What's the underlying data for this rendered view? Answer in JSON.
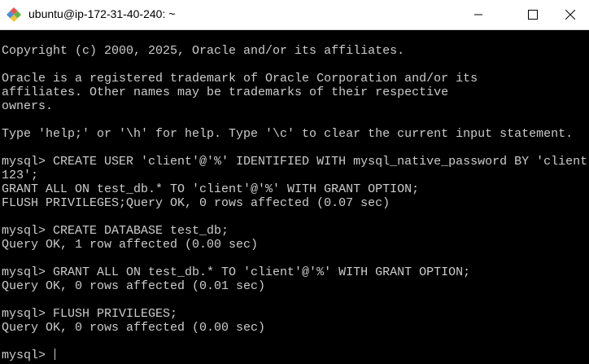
{
  "window": {
    "title": "ubuntu@ip-172-31-40-240: ~",
    "app_icon": "git-bash-diamond-icon"
  },
  "terminal": {
    "lines": [
      "",
      "Copyright (c) 2000, 2025, Oracle and/or its affiliates.",
      "",
      "Oracle is a registered trademark of Oracle Corporation and/or its",
      "affiliates. Other names may be trademarks of their respective",
      "owners.",
      "",
      "Type 'help;' or '\\h' for help. Type '\\c' to clear the current input statement.",
      "",
      "mysql> CREATE USER 'client'@'%' IDENTIFIED WITH mysql_native_password BY 'client",
      "123';",
      "GRANT ALL ON test_db.* TO 'client'@'%' WITH GRANT OPTION;",
      "FLUSH PRIVILEGES;Query OK, 0 rows affected (0.07 sec)",
      "",
      "mysql> CREATE DATABASE test_db;",
      "Query OK, 1 row affected (0.00 sec)",
      "",
      "mysql> GRANT ALL ON test_db.* TO 'client'@'%' WITH GRANT OPTION;",
      "Query OK, 0 rows affected (0.01 sec)",
      "",
      "mysql> FLUSH PRIVILEGES;",
      "Query OK, 0 rows affected (0.00 sec)",
      ""
    ],
    "prompt": "mysql> "
  }
}
